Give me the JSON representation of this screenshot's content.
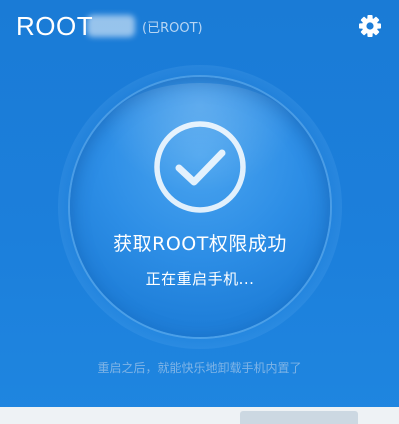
{
  "header": {
    "title": "ROOT",
    "status": "(已ROOT)",
    "settings_icon": "gear-icon"
  },
  "main": {
    "status_icon": "check-circle-icon",
    "title": "获取ROOT权限成功",
    "subtitle": "正在重启手机..."
  },
  "footer": {
    "hint": "重启之后，就能快乐地卸载手机内置了"
  },
  "colors": {
    "background": "#1c7dd8",
    "circle": "#2d8ee6",
    "hint_text": "#7fb4e6",
    "status_text": "#b8d6f3"
  }
}
